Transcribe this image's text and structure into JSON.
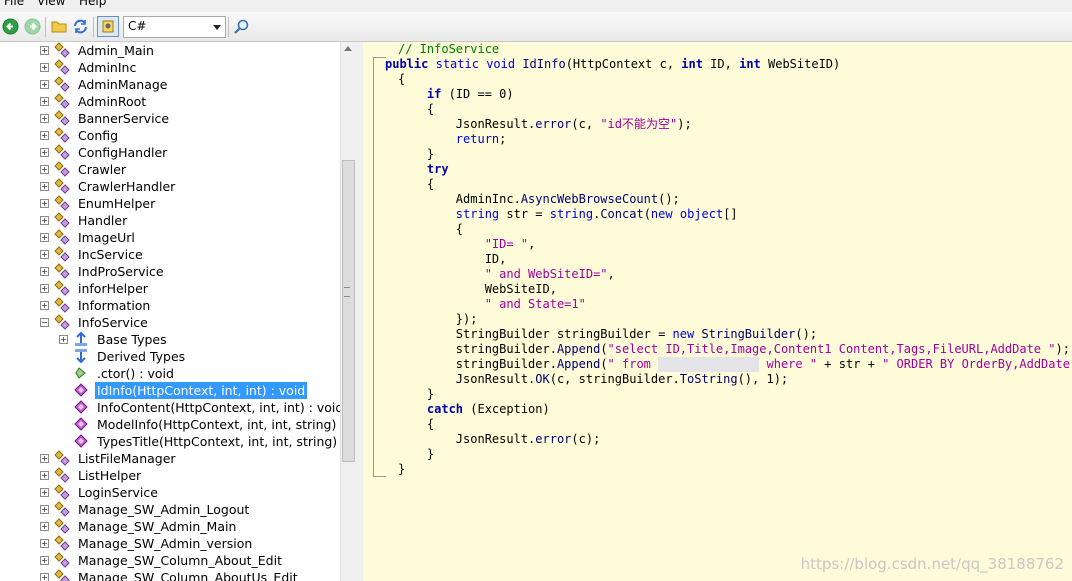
{
  "menu": {
    "file": "File",
    "view": "View",
    "help": "Help"
  },
  "toolbar": {
    "language": "C#"
  },
  "tree": {
    "items": [
      "Admin_Main",
      "AdminInc",
      "AdminManage",
      "AdminRoot",
      "BannerService",
      "Config",
      "ConfigHandler",
      "Crawler",
      "CrawlerHandler",
      "EnumHelper",
      "Handler",
      "ImageUrl",
      "IncService",
      "IndProService",
      "inforHelper",
      "Information",
      "InfoService",
      "Base Types",
      "Derived Types",
      ".ctor() : void",
      "IdInfo(HttpContext, int, int) : void",
      "InfoContent(HttpContext, int, int) : void",
      "ModelInfo(HttpContext, int, int, string) : vo",
      "TypesTitle(HttpContext, int, int, string) : vo",
      "ListFileManager",
      "ListHelper",
      "LoginService",
      "Manage_SW_Admin_Logout",
      "Manage_SW_Admin_Main",
      "Manage_SW_Admin_version",
      "Manage_SW_Column_About_Edit",
      "Manage_SW_Column_AboutUs_Edit"
    ]
  },
  "code": {
    "comment": "// InfoService",
    "kw_public": "public",
    "kw_static": "static",
    "kw_void": "void",
    "method_name": "IdInfo",
    "sig_rest_1": "(HttpContext c, ",
    "kw_int": "int",
    "sig_id": " ID, ",
    "sig_site": " WebSiteID)",
    "brace_open": "{",
    "brace_close": "}",
    "brace_close_last": "}",
    "kw_if": "if",
    "if_cond": " (ID == 0)",
    "l5_a": "JsonResult.",
    "l5_m": "error",
    "l5_b": "(c, ",
    "l5_s": "\"id不能为空\"",
    "l5_c": ");",
    "kw_return": "return",
    "semicolon": ";",
    "kw_try": "try",
    "l11_a": "AdminInc.",
    "l11_m": "AsyncWebBrowseCount",
    "l11_b": "();",
    "kw_string": "string",
    "l12_a": " str = ",
    "l12_m": "Concat",
    "l12_b": "(",
    "kw_new": "new",
    "kw_object": "object",
    "l12_c": "[]",
    "s_id": "\"ID= \"",
    "comma": ",",
    "id_line": "ID,",
    "s_site": "\" and WebSiteID=\"",
    "site_line": "WebSiteID,",
    "s_state": "\" and State=1\"",
    "close_arr": "});",
    "l21_a": "StringBuilder stringBuilder = ",
    "l21_b": " StringBuilder",
    "l21_c": "();",
    "sb_var": "stringBuilder.",
    "append": "Append",
    "l22_s": "\"select ID,Title,Image,Content1 Content,Tags,FileURL,AddDate \"",
    "l22_e": ");",
    "l23_s1": "\" from ",
    "l23_blur": "xxxxxxxxxxxxxx",
    "l23_s2": " where \"",
    "l23_mid": " + str + ",
    "l23_s3": "\" ORDER BY OrderBy,AddDate\"",
    "l24_a": "JsonResult.",
    "l24_m": "OK",
    "l24_b": "(c, stringBuilder.",
    "l24_m2": "ToString",
    "l24_c": "(), 1);",
    "kw_catch": "catch",
    "catch_rest": " (Exception)",
    "l29_m": "error",
    "l29_b": "(c);"
  },
  "watermark": "https://blog.csdn.net/qq_38188762"
}
